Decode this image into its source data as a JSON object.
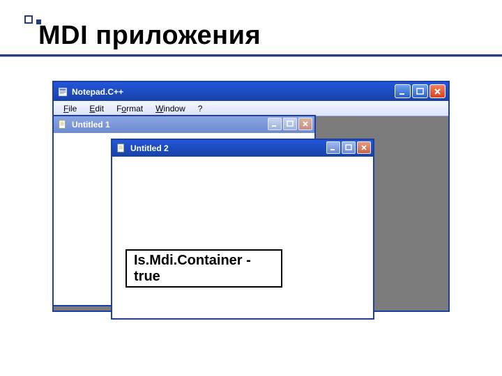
{
  "slide": {
    "title": "MDI приложения",
    "callout": "Is.Mdi.Container - true"
  },
  "parentWindow": {
    "title": "Notepad.С++",
    "menu": {
      "file": "File",
      "edit": "Edit",
      "format": "Format",
      "window": "Window",
      "help": "?"
    }
  },
  "child1": {
    "title": "Untitled 1"
  },
  "child2": {
    "title": "Untitled 2"
  },
  "icons": {
    "app": "app-icon",
    "doc": "doc-icon",
    "min": "minimize-icon",
    "max": "maximize-icon",
    "close": "close-icon"
  }
}
